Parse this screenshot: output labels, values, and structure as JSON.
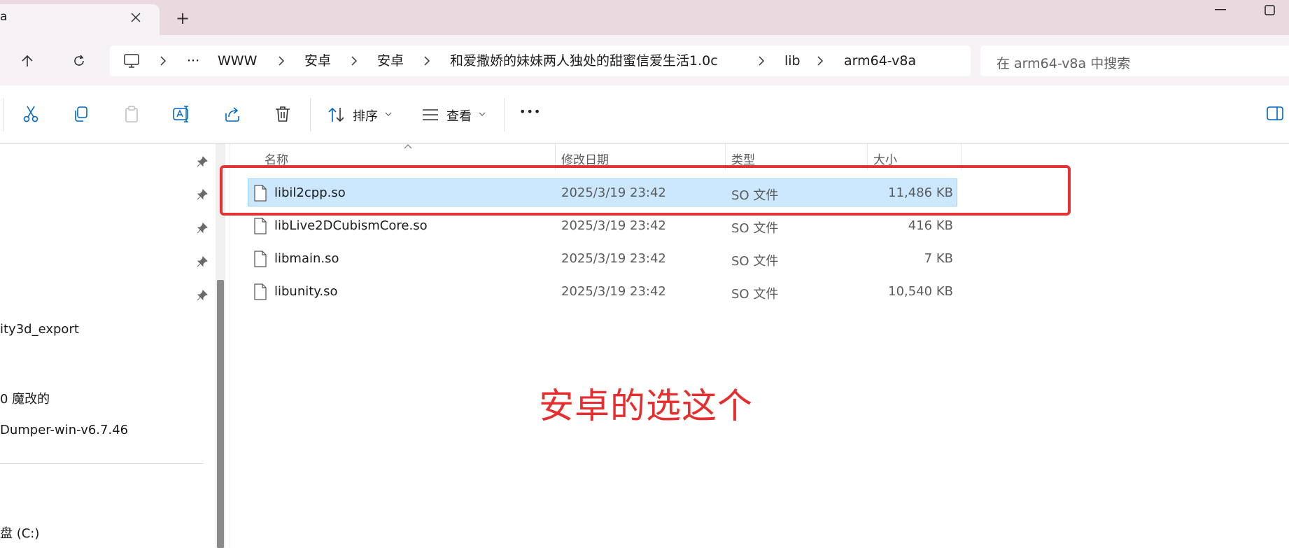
{
  "window": {
    "tab_title": "a",
    "new_tab_label": "+"
  },
  "address": {
    "overflow_label": "···",
    "breadcrumbs": [
      "WWW",
      "安卓",
      "安卓",
      "和爱撒娇的妹妹两人独处的甜蜜信爱生活1.0c",
      "lib",
      "arm64-v8a"
    ]
  },
  "search": {
    "placeholder": "在 arm64-v8a 中搜索"
  },
  "toolbar": {
    "sort_label": "排序",
    "view_label": "查看",
    "more_label": "•••"
  },
  "sidebar": {
    "items": [
      {
        "label": "ity3d_export"
      },
      {
        "label": "0 魔改的"
      },
      {
        "label": "Dumper-win-v6.7.46"
      },
      {
        "label": "盘 (C:)"
      }
    ]
  },
  "columns": {
    "name": "名称",
    "date": "修改日期",
    "type": "类型",
    "size": "大小"
  },
  "files": [
    {
      "name": "libil2cpp.so",
      "date": "2025/3/19 23:42",
      "type": "SO 文件",
      "size": "11,486 KB",
      "selected": true
    },
    {
      "name": "libLive2DCubismCore.so",
      "date": "2025/3/19 23:42",
      "type": "SO 文件",
      "size": "416 KB",
      "selected": false
    },
    {
      "name": "libmain.so",
      "date": "2025/3/19 23:42",
      "type": "SO 文件",
      "size": "7 KB",
      "selected": false
    },
    {
      "name": "libunity.so",
      "date": "2025/3/19 23:42",
      "type": "SO 文件",
      "size": "10,540 KB",
      "selected": false
    }
  ],
  "annotation": {
    "text": "安卓的选这个",
    "color": "#e62e2e"
  },
  "colors": {
    "titlebar": "#ebd9e0",
    "selection": "#cce8ff",
    "accent": "#0067c0"
  }
}
